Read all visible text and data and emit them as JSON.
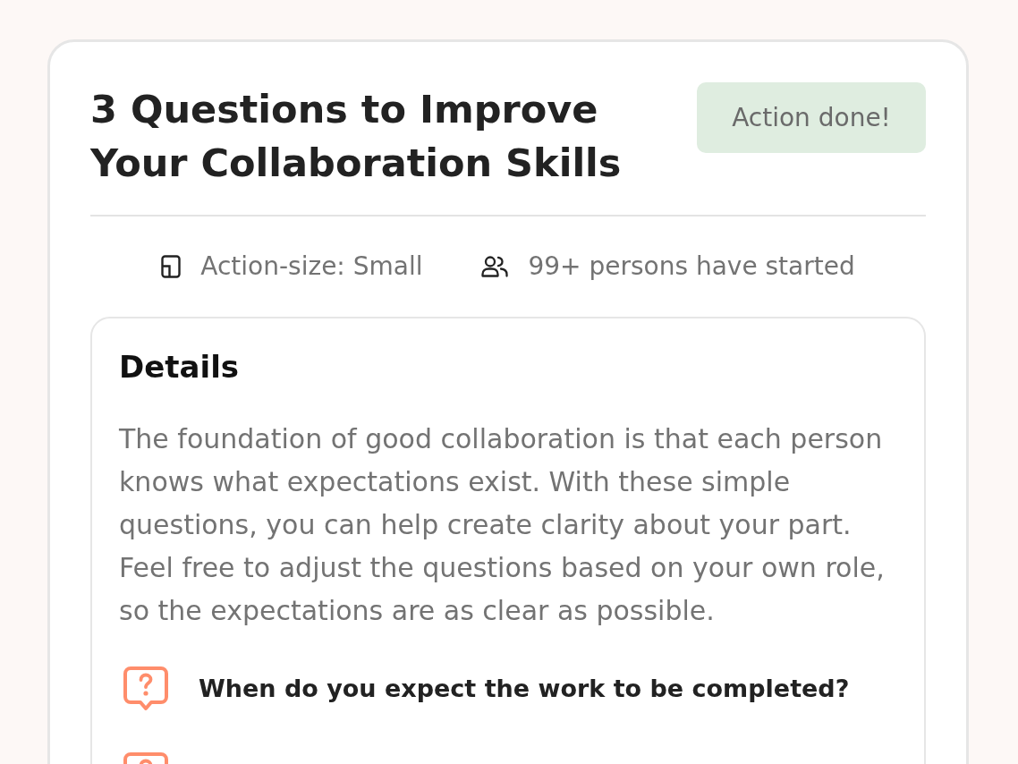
{
  "card": {
    "title": "3 Questions to Improve Your Collaboration Skills",
    "status_button": {
      "label": "Action done!"
    },
    "meta": [
      {
        "kind": "size",
        "text": "Action-size: Small"
      },
      {
        "kind": "participants",
        "text": "99+ persons have started"
      }
    ],
    "details": {
      "heading": "Details",
      "description": "The foundation of good collaboration is that each person knows what expectations exist. With these simple questions, you can help create clarity about your part. Feel free to adjust the questions based on your own role, so the expectations are as clear as possible.",
      "questions": [
        {
          "kind": "question",
          "text": "When do you expect the work to be completed?"
        },
        {
          "kind": "question"
        }
      ]
    }
  }
}
